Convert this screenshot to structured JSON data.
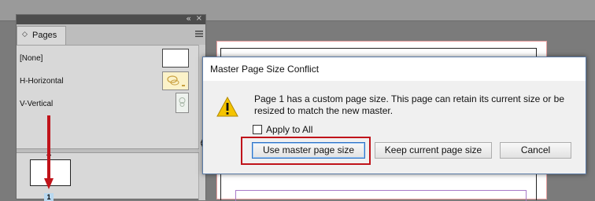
{
  "pages_panel": {
    "tab_label": "Pages",
    "masters": [
      {
        "label": "[None]"
      },
      {
        "label": "H-Horizontal"
      },
      {
        "label": "V-Vertical"
      }
    ],
    "page_number": "1"
  },
  "dialog": {
    "title": "Master Page Size Conflict",
    "message": "Page 1 has a custom page size. This page can retain its current size or be resized to match the new master.",
    "apply_to_all_label": "Apply to All",
    "apply_to_all_checked": false,
    "buttons": {
      "use_master": "Use master page size",
      "keep_current": "Keep current page size",
      "cancel": "Cancel"
    }
  },
  "colors": {
    "annotation": "#c0131a",
    "warning": "#f5c400",
    "page_number_bg": "#b8d8f0"
  },
  "icons": {
    "warning": "warning-triangle-icon",
    "menu": "hamburger-menu-icon",
    "collapse": "double-chevron-left-icon",
    "annotation": "red-down-arrow"
  }
}
